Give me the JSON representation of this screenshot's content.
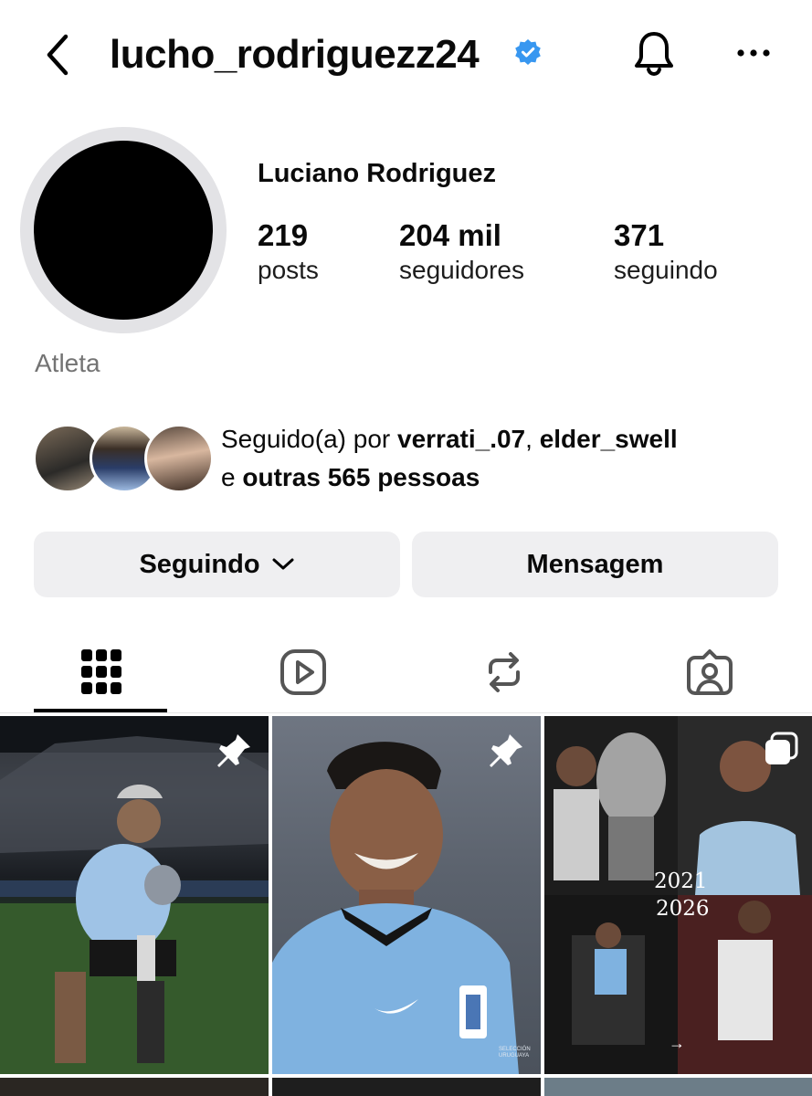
{
  "header": {
    "username": "lucho_rodriguezz24",
    "back_icon": "chevron-left-icon",
    "verified_icon": "verified-badge-icon",
    "notifications_icon": "bell-icon",
    "more_icon": "more-horizontal-icon"
  },
  "profile": {
    "full_name": "Luciano Rodriguez",
    "category": "Atleta",
    "stats": [
      {
        "value": "219",
        "label": "posts"
      },
      {
        "value": "204 mil",
        "label": "seguidores"
      },
      {
        "value": "371",
        "label": "seguindo"
      }
    ]
  },
  "followed_by": {
    "prefix": "Seguido(a) por ",
    "user1": "verrati_.07",
    "sep": ", ",
    "user2": "elder_swell",
    "and": "e ",
    "others": "outras 565 pessoas"
  },
  "actions": {
    "following_label": "Seguindo",
    "message_label": "Mensagem"
  },
  "tabs": [
    {
      "name": "posts",
      "icon": "grid-icon",
      "selected": true
    },
    {
      "name": "reels",
      "icon": "reels-icon",
      "selected": false
    },
    {
      "name": "reposts",
      "icon": "repost-icon",
      "selected": false
    },
    {
      "name": "tagged",
      "icon": "tagged-person-icon",
      "selected": false
    }
  ],
  "posts": [
    {
      "pinned": true
    },
    {
      "pinned": true,
      "caption": "SELECCIÓN URUGUAYA"
    },
    {
      "multi": true,
      "years": [
        "2021",
        "2026"
      ],
      "arrow": "→"
    }
  ],
  "colors": {
    "verified": "#3897f0",
    "button_bg": "#efeff1",
    "secondary_text": "#737373"
  }
}
